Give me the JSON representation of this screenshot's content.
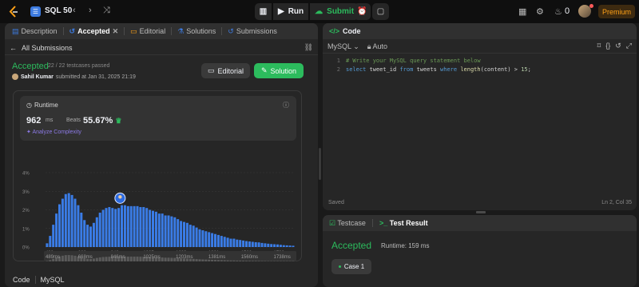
{
  "topbar": {
    "crumb": "SQL 50",
    "run": "Run",
    "submit": "Submit",
    "streak": "0",
    "premium": "Premium",
    "icons": [
      "leetcode-logo",
      "list-icon",
      "chevron-left-icon",
      "chevron-right-icon",
      "shuffle-icon",
      "debug-icon",
      "play-icon",
      "cloud-upload-icon",
      "alarm-icon",
      "note-icon",
      "layout-icon",
      "gear-icon",
      "fire-icon"
    ]
  },
  "left": {
    "tabs": [
      {
        "label": "Description",
        "icon": "description-icon"
      },
      {
        "label": "Accepted",
        "icon": "history-icon",
        "active": true
      },
      {
        "label": "Editorial",
        "icon": "book-icon"
      },
      {
        "label": "Solutions",
        "icon": "flask-icon"
      },
      {
        "label": "Submissions",
        "icon": "history-icon"
      }
    ],
    "back": "All Submissions",
    "status": "Accepted",
    "passed": "22 / 22 testcases passed",
    "author": "Sahil Kumar",
    "submitted": "submitted at Jan 31, 2025 21:19",
    "editorial_btn": "Editorial",
    "solution_btn": "Solution",
    "runtime": {
      "title": "Runtime",
      "value": "962",
      "unit": "ms",
      "beats_label": "Beats",
      "beats_pct": "55.67%",
      "analyze": "Analyze Complexity"
    },
    "bottom_tab": "Code",
    "bottom_lang": "MySQL"
  },
  "chart_data": {
    "type": "bar",
    "ylim": [
      0,
      4
    ],
    "yticks": [
      "4%",
      "3%",
      "2%",
      "1%",
      "0%"
    ],
    "xticks": [
      "489ms",
      "668ms",
      "846ms",
      "1025ms",
      "1203ms",
      "1381ms",
      "1560ms",
      "1738ms"
    ],
    "values": [
      0.2,
      0.6,
      1.2,
      1.8,
      2.3,
      2.6,
      2.85,
      2.9,
      2.8,
      2.6,
      2.25,
      1.85,
      1.45,
      1.2,
      1.1,
      1.3,
      1.6,
      1.85,
      2.0,
      2.1,
      2.15,
      2.1,
      2.05,
      2.1,
      2.25,
      2.25,
      2.2,
      2.2,
      2.2,
      2.2,
      2.15,
      2.15,
      2.1,
      2.0,
      1.95,
      1.9,
      1.8,
      1.8,
      1.7,
      1.7,
      1.65,
      1.6,
      1.5,
      1.4,
      1.35,
      1.3,
      1.2,
      1.15,
      1.05,
      0.95,
      0.9,
      0.85,
      0.8,
      0.75,
      0.7,
      0.65,
      0.6,
      0.55,
      0.5,
      0.45,
      0.45,
      0.4,
      0.38,
      0.35,
      0.32,
      0.3,
      0.28,
      0.26,
      0.25,
      0.22,
      0.2,
      0.18,
      0.16,
      0.15,
      0.14,
      0.12,
      0.1,
      0.09,
      0.08,
      0.07
    ],
    "highlight_index": 26,
    "color": "#3a7ce6",
    "overview_xticks": [
      "489ms",
      "668ms",
      "846ms",
      "1025ms",
      "1203ms",
      "1381ms",
      "1560ms",
      "1738ms"
    ]
  },
  "code": {
    "header": "Code",
    "lang": "MySQL",
    "auto": "Auto",
    "lines": [
      {
        "n": "1",
        "tokens": [
          {
            "c": "cmt",
            "t": "# Write your MySQL query statement below"
          }
        ]
      },
      {
        "n": "2",
        "tokens": [
          {
            "c": "kw",
            "t": "select"
          },
          {
            "c": "txt",
            "t": " tweet_id "
          },
          {
            "c": "kw",
            "t": "from"
          },
          {
            "c": "txt",
            "t": " tweets "
          },
          {
            "c": "kw",
            "t": "where"
          },
          {
            "c": "txt",
            "t": " "
          },
          {
            "c": "fn",
            "t": "length"
          },
          {
            "c": "txt",
            "t": "(content) > "
          },
          {
            "c": "num",
            "t": "15"
          },
          {
            "c": "txt",
            "t": ";"
          }
        ]
      }
    ],
    "saved": "Saved",
    "position": "Ln 2, Col 35"
  },
  "test": {
    "tab1": "Testcase",
    "tab2": "Test Result",
    "status": "Accepted",
    "runtime": "Runtime: 159 ms",
    "case": "Case 1"
  },
  "colors": {
    "accent": "#2cbb5d",
    "bar": "#3a7ce6",
    "premium": "#ffa116"
  }
}
